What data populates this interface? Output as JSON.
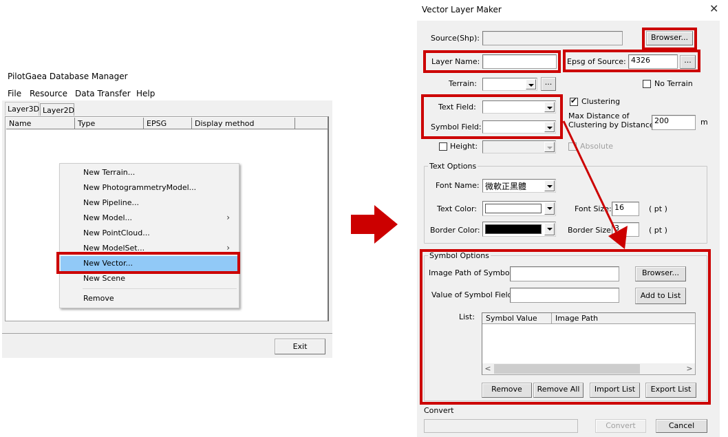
{
  "left_window": {
    "title": "PilotGaea Database Manager",
    "menu": [
      "File",
      "Resource",
      "Data Transfer",
      "Help"
    ],
    "tabs": [
      {
        "label": "Layer3D",
        "active": true
      },
      {
        "label": "Layer2D",
        "active": false
      }
    ],
    "columns": [
      "Name",
      "Type",
      "EPSG",
      "Display method",
      ""
    ],
    "rows": [],
    "exit_label": "Exit",
    "context_menu": {
      "items": [
        {
          "label": "New Terrain...",
          "submenu": false,
          "highlighted": false
        },
        {
          "label": "New PhotogrammetryModel...",
          "submenu": false,
          "highlighted": false
        },
        {
          "label": "New Pipeline...",
          "submenu": false,
          "highlighted": false
        },
        {
          "label": "New Model...",
          "submenu": true,
          "highlighted": false
        },
        {
          "label": "New PointCloud...",
          "submenu": false,
          "highlighted": false
        },
        {
          "label": "New ModelSet...",
          "submenu": true,
          "highlighted": false
        },
        {
          "label": "New Vector...",
          "submenu": false,
          "highlighted": true
        },
        {
          "label": "New Scene",
          "submenu": false,
          "highlighted": false
        },
        {
          "label": "Remove",
          "submenu": false,
          "highlighted": false
        }
      ],
      "submenu_glyph": "›"
    }
  },
  "arrow_icon": "right-arrow-icon",
  "dialog": {
    "title": "Vector Layer Maker",
    "close_glyph": "✕",
    "source_label": "Source(Shp):",
    "source_value": "",
    "browser_label": "Browser...",
    "layer_name_label": "Layer Name:",
    "layer_name_value": "",
    "epsg_label": "Epsg of Source:",
    "epsg_value": "4326",
    "epsg_more_label": "...",
    "terrain_label": "Terrain:",
    "terrain_value": "",
    "terrain_more_label": "...",
    "no_terrain_label": "No Terrain",
    "no_terrain_checked": false,
    "text_field_label": "Text Field:",
    "text_field_value": "",
    "symbol_field_label": "Symbol Field:",
    "symbol_field_value": "",
    "clustering_label": "Clustering",
    "clustering_checked": true,
    "max_distance_label_1": "Max Distance of",
    "max_distance_label_2": "Clustering by Distance:",
    "max_distance_value": "200",
    "max_distance_unit": "m",
    "height_label": "Height:",
    "height_checked": false,
    "height_value": "",
    "absolute_label": "Absolute",
    "absolute_checked": false,
    "check_glyph": "✔",
    "text_options": {
      "title": "Text Options",
      "font_name_label": "Font Name:",
      "font_name_value": "微軟正黑體",
      "text_color_label": "Text Color:",
      "text_color": "#ffffff",
      "font_size_label": "Font Size:",
      "font_size_value": "16",
      "font_size_unit": "( pt )",
      "border_color_label": "Border Color:",
      "border_color": "#000000",
      "border_size_label": "Border Size:",
      "border_size_value": "3",
      "border_size_unit": "( pt )"
    },
    "symbol_options": {
      "title": "Symbol Options",
      "image_path_label": "Image Path of Symbol:",
      "image_path_value": "",
      "browser_label": "Browser...",
      "symbol_value_label": "Value of Symbol Field:",
      "symbol_value_value": "",
      "add_label": "Add to List",
      "list_label": "List:",
      "list_columns": [
        "Symbol Value",
        "Image Path"
      ],
      "list_rows": [],
      "scroll_left": "<",
      "scroll_right": ">",
      "remove_label": "Remove",
      "remove_all_label": "Remove All",
      "import_label": "Import List",
      "export_label": "Export List"
    },
    "convert_section_label": "Convert",
    "convert_progress": 0,
    "convert_label": "Convert",
    "cancel_label": "Cancel"
  },
  "annotation_color": "#cc0000"
}
